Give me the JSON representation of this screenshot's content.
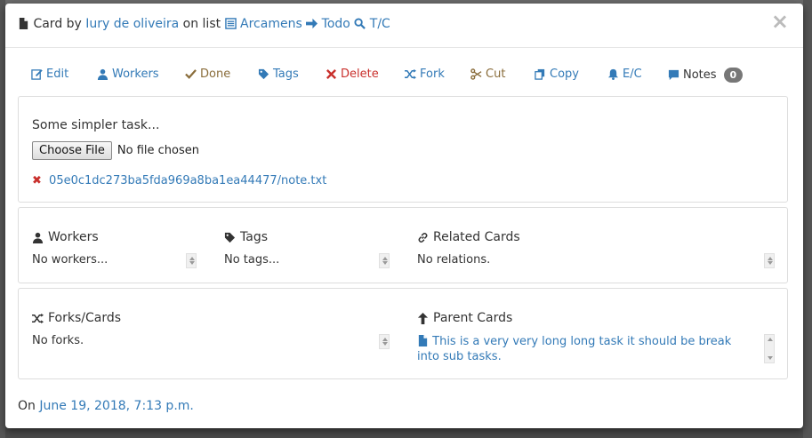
{
  "header": {
    "prefix": "Card by",
    "author": "Iury de oliveira",
    "on_list": "on list",
    "board": "Arcamens",
    "list": "Todo",
    "search_label": "T/C",
    "close_label": "×"
  },
  "toolbar": {
    "edit": "Edit",
    "workers": "Workers",
    "done": "Done",
    "tags": "Tags",
    "delete": "Delete",
    "fork": "Fork",
    "cut": "Cut",
    "copy": "Copy",
    "ec": "E/C",
    "notes": "Notes",
    "notes_count": "0"
  },
  "card": {
    "description": "Some simpler task...",
    "file_button": "Choose File",
    "file_status": "No file chosen",
    "attachment": "05e0c1dc273ba5fda969a8ba1ea44477/note.txt"
  },
  "relations": {
    "workers_title": "Workers",
    "workers_empty": "No workers...",
    "tags_title": "Tags",
    "tags_empty": "No tags...",
    "related_title": "Related Cards",
    "related_empty": "No relations."
  },
  "forks": {
    "forks_title": "Forks/Cards",
    "forks_empty": "No forks.",
    "parent_title": "Parent Cards",
    "parent_item": "This is a very very long long task it should be break into sub tasks."
  },
  "footer": {
    "on": "On",
    "date": "June 19, 2018, 7:13 p.m."
  },
  "colors": {
    "link": "#337ab7",
    "done": "#8a6d3b",
    "delete": "#c9302c",
    "badge": "#777777"
  }
}
